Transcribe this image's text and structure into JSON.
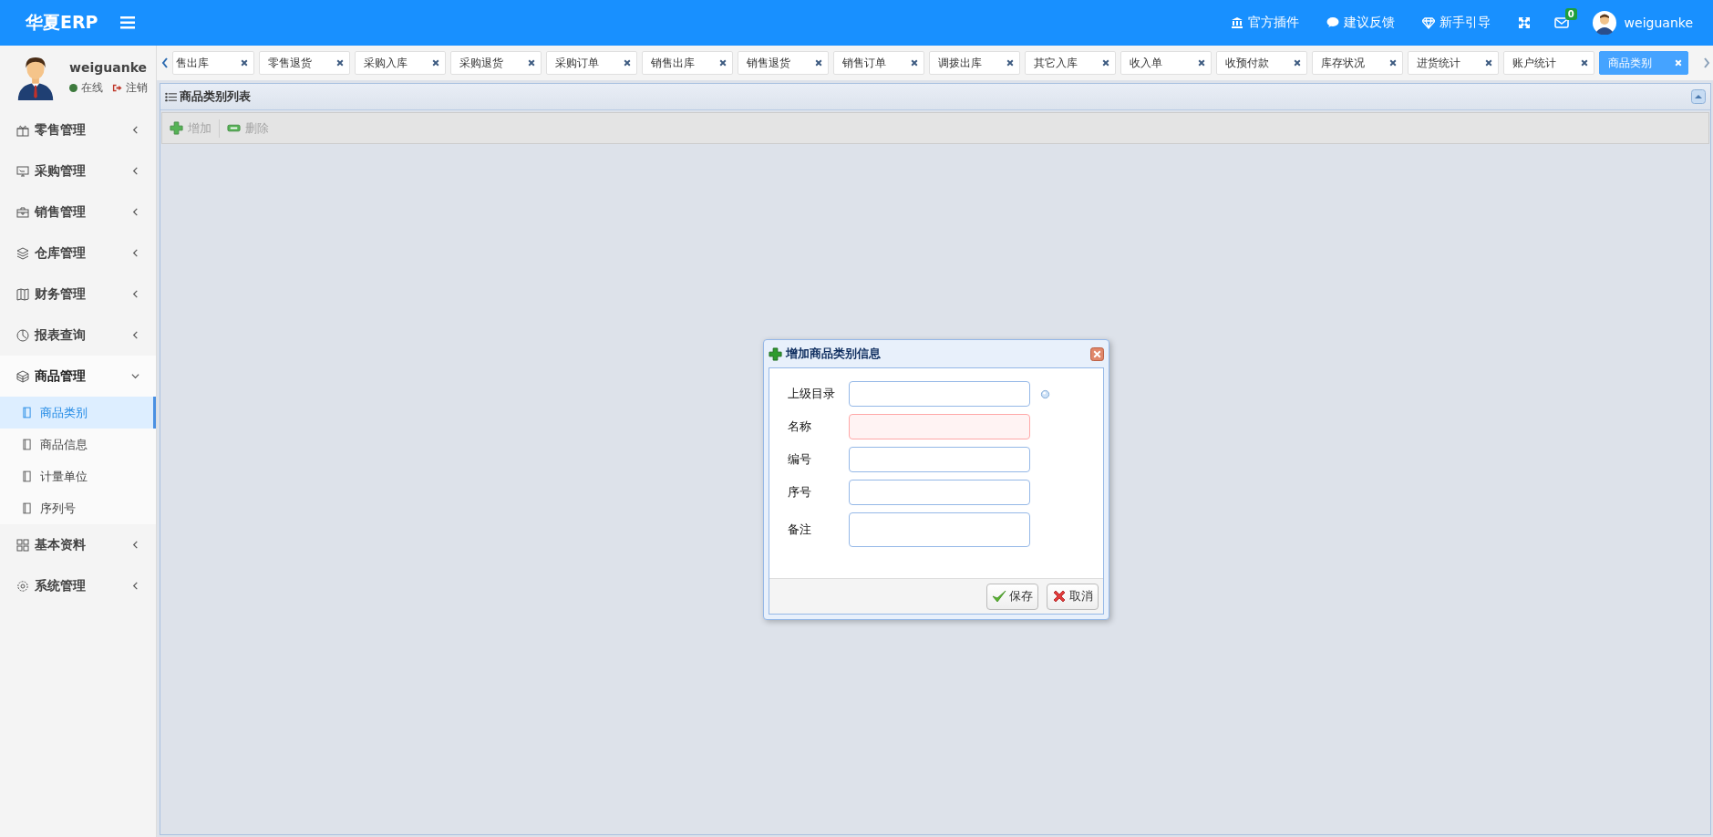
{
  "header": {
    "logo": "华夏ERP",
    "links": [
      {
        "kind": "plugin",
        "label": "官方插件"
      },
      {
        "kind": "feedback",
        "label": "建议反馈"
      },
      {
        "kind": "guide",
        "label": "新手引导"
      }
    ],
    "mail_count": "0",
    "username": "weiguanke"
  },
  "user": {
    "name": "weiguanke",
    "online": true,
    "status": "在线",
    "logout": "注销"
  },
  "sidebar": {
    "items": [
      {
        "label": "零售管理",
        "expanded": false
      },
      {
        "label": "采购管理",
        "expanded": false
      },
      {
        "label": "销售管理",
        "expanded": false
      },
      {
        "label": "仓库管理",
        "expanded": false
      },
      {
        "label": "财务管理",
        "expanded": false
      },
      {
        "label": "报表查询",
        "expanded": false
      },
      {
        "label": "商品管理",
        "expanded": true,
        "children": [
          {
            "label": "商品类别",
            "selected": true
          },
          {
            "label": "商品信息",
            "selected": false
          },
          {
            "label": "计量单位",
            "selected": false
          },
          {
            "label": "序列号",
            "selected": false
          }
        ]
      },
      {
        "label": "基本资料",
        "expanded": false
      },
      {
        "label": "系统管理",
        "expanded": false
      }
    ]
  },
  "tabs": [
    {
      "label": "售出库",
      "selected": false
    },
    {
      "label": "零售退货",
      "selected": false
    },
    {
      "label": "采购入库",
      "selected": false
    },
    {
      "label": "采购退货",
      "selected": false
    },
    {
      "label": "采购订单",
      "selected": false
    },
    {
      "label": "销售出库",
      "selected": false
    },
    {
      "label": "销售退货",
      "selected": false
    },
    {
      "label": "销售订单",
      "selected": false
    },
    {
      "label": "调拨出库",
      "selected": false
    },
    {
      "label": "其它入库",
      "selected": false
    },
    {
      "label": "收入单",
      "selected": false
    },
    {
      "label": "收预付款",
      "selected": false
    },
    {
      "label": "库存状况",
      "selected": false
    },
    {
      "label": "进货统计",
      "selected": false
    },
    {
      "label": "账户统计",
      "selected": false
    },
    {
      "label": "商品类别",
      "selected": true
    }
  ],
  "panel": {
    "title": "商品类别列表",
    "toolbar": [
      {
        "kind": "add",
        "label": "增加",
        "disabled": true
      },
      {
        "kind": "delete",
        "label": "删除",
        "disabled": true
      }
    ]
  },
  "dialog": {
    "title": "增加商品类别信息",
    "fields": [
      {
        "label": "上级目录",
        "kind": "lookup",
        "invalid": false
      },
      {
        "label": "名称",
        "kind": "text",
        "invalid": true
      },
      {
        "label": "编号",
        "kind": "text",
        "invalid": false
      },
      {
        "label": "序号",
        "kind": "text",
        "invalid": false
      },
      {
        "label": "备注",
        "kind": "textarea",
        "invalid": false
      }
    ],
    "buttons": [
      {
        "kind": "save",
        "label": "保存"
      },
      {
        "kind": "cancel",
        "label": "取消"
      }
    ]
  }
}
